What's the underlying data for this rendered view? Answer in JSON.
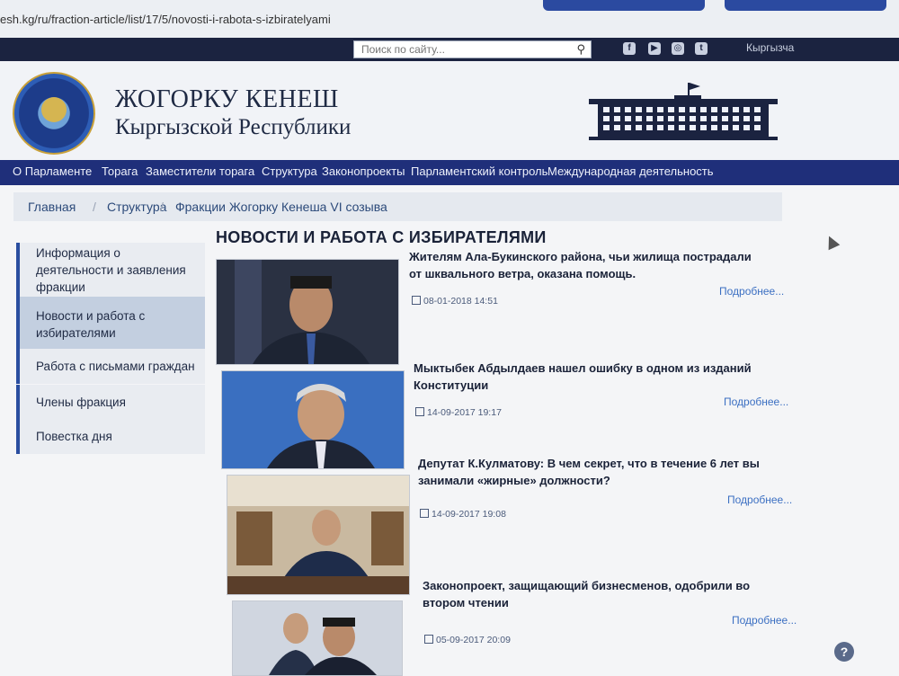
{
  "browser": {
    "url": "esh.kg/ru/fraction-article/list/17/5/novosti-i-rabota-s-izbiratelyami"
  },
  "topbar": {
    "search_placeholder": "Поиск по сайту...",
    "language": "Кыргызча",
    "social": [
      {
        "icon": "facebook-icon",
        "glyph": "f"
      },
      {
        "icon": "youtube-icon",
        "glyph": "▶"
      },
      {
        "icon": "instagram-icon",
        "glyph": "◎"
      },
      {
        "icon": "twitter-icon",
        "glyph": "t"
      }
    ]
  },
  "header": {
    "title_line1": "ЖОГОРКУ КЕНЕШ",
    "title_line2": "Кыргызской Республики"
  },
  "nav": {
    "items": [
      "О Парламенте",
      "Торага",
      "Заместители торага",
      "Структура",
      "Законопроекты",
      "Парламентский контроль",
      "Международная деятельность"
    ]
  },
  "breadcrumb": {
    "items": [
      "Главная",
      "Структура",
      "Фракции Жогорку Кенеша VI созыва"
    ]
  },
  "sidebar": {
    "items": [
      {
        "label": "Информация о деятельности и заявления фракции"
      },
      {
        "label": "Новости и работа с избирателями"
      },
      {
        "label": "Работа с письмами граждан"
      },
      {
        "label": "Члены фракция"
      },
      {
        "label": "Повестка дня"
      }
    ]
  },
  "main": {
    "heading": "НОВОСТИ И РАБОТА С ИЗБИРАТЕЛЯМИ",
    "more_label": "Подробнее...",
    "news": [
      {
        "title": "Жителям Ала-Букинского района, чьи жилища пострадали от шквального ветра, оказана помощь.",
        "date": "08-01-2018 14:51"
      },
      {
        "title": "Мыктыбек Абдылдаев нашел ошибку в одном из изданий Конституции",
        "date": "14-09-2017 19:17"
      },
      {
        "title": "Депутат К.Кулматову: В чем секрет, что в течение 6 лет вы занимали «жирные» должности?",
        "date": "14-09-2017 19:08"
      },
      {
        "title": "Законопроект, защищающий бизнесменов, одобрили во втором чтении",
        "date": "05-09-2017 20:09"
      }
    ]
  },
  "colors": {
    "nav_bg": "#1f2f7a",
    "accent": "#2a4ea0",
    "link": "#3b6fc2"
  }
}
